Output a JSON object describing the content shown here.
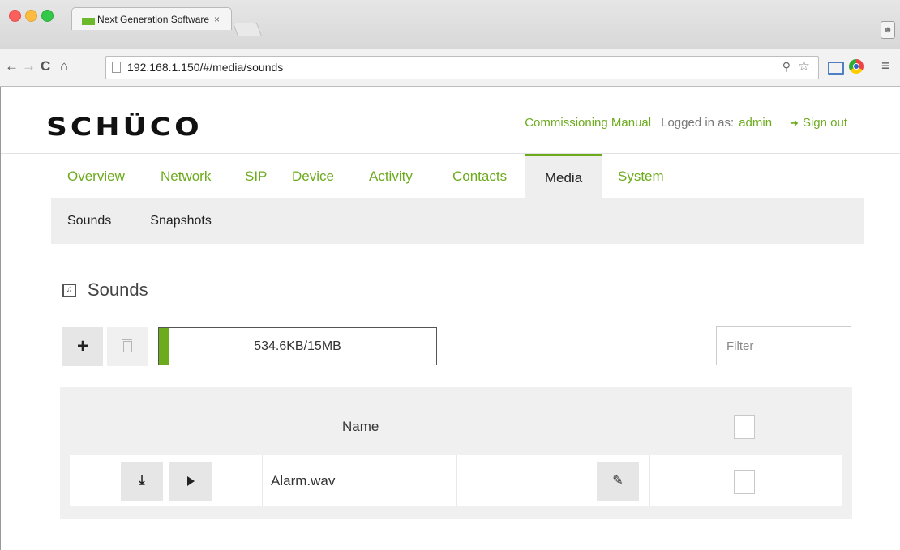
{
  "browser": {
    "tab_title": "Next Generation Software (",
    "tab_close": "×",
    "url": "192.168.1.150/#/media/sounds"
  },
  "header": {
    "logo": "SCHÜCO",
    "commissioning_manual": "Commissioning Manual",
    "logged_in_label": "Logged in as:",
    "user": "admin",
    "sign_out": "Sign out"
  },
  "main_nav": {
    "items": [
      "Overview",
      "Network",
      "SIP",
      "Device",
      "Activity",
      "Contacts",
      "Media",
      "System"
    ],
    "active": "Media"
  },
  "sub_nav": {
    "items": [
      "Sounds",
      "Snapshots"
    ]
  },
  "content": {
    "title": "Sounds",
    "add_symbol": "+",
    "storage_text": "534.6KB/15MB",
    "storage_used_percent": 3.5,
    "filter_placeholder": "Filter",
    "table": {
      "header_name": "Name",
      "rows": [
        {
          "name": "Alarm.wav"
        }
      ]
    }
  },
  "colors": {
    "accent": "#6cab1d",
    "nav_bg": "#eeeeee",
    "table_bg": "#f0f0f0"
  }
}
